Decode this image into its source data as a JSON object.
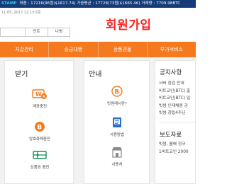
{
  "ticker": {
    "brand": "STAMP",
    "text": "최종 : 17216(96원($1617.74) 가중평균 : 17728(73원($1665.46) 거래량 : 7709.98BTC"
  },
  "date_text": "11.05, 2017.12.13기준",
  "tabs": [
    "",
    "인트",
    "나방"
  ],
  "signup_title": "회원가입",
  "colors": {
    "nav": "#f4791f",
    "accent_red": "#ff2020",
    "ticker_bg": "#163c77",
    "icon_orange": "#f4791f"
  },
  "nav": [
    "지갑관리",
    "송금대행",
    "상품권몰",
    "부가서비스"
  ],
  "receive": {
    "title": "받기",
    "items": [
      {
        "label": "계좌충전",
        "icon": "won-card-icon"
      },
      {
        "label": "암호화폐충전",
        "icon": "bitcoin-coin-icon"
      },
      {
        "label": "상품권 충전",
        "icon": "gift-card-icon"
      }
    ]
  },
  "guide": {
    "title": "안내",
    "items": [
      {
        "label": "빗썸래시란?",
        "icon": "bitcoin-info-icon"
      },
      {
        "label": "사용방법",
        "icon": "manual-book-icon"
      },
      {
        "label": "사용처",
        "icon": "store-icon"
      }
    ]
  },
  "notice": {
    "title": "공지사항",
    "items": [
      "서버 점검 안내",
      "비트코인(BTC) 출",
      "비트코인(BTC) 입",
      "빗썸 인재채용 공",
      "빗썸 창립4주년"
    ]
  },
  "press": {
    "title": "보도자료",
    "items": [
      "빗썸, 올해 정규",
      "1비트코인 2000"
    ]
  }
}
